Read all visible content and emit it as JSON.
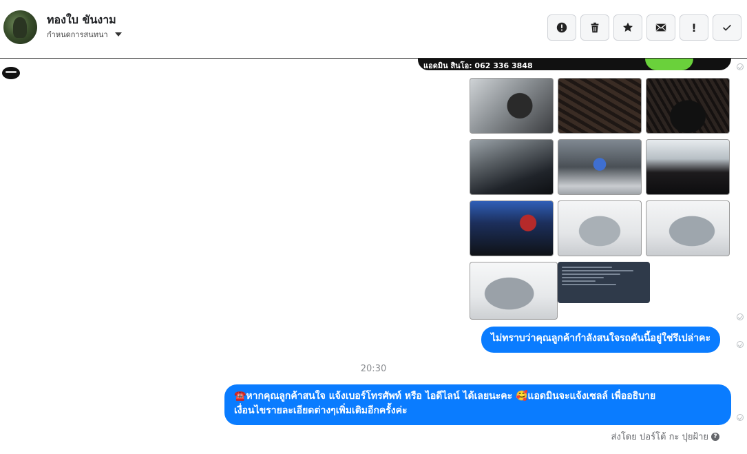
{
  "header": {
    "contact_name": "ทองใบ ขันงาม",
    "assign_label": "กำหนดการสนทนา",
    "actions": [
      {
        "name": "mark-spam-button",
        "icon": "alert-circle-icon"
      },
      {
        "name": "delete-button",
        "icon": "trash-icon"
      },
      {
        "name": "star-button",
        "icon": "star-icon"
      },
      {
        "name": "mark-unread-button",
        "icon": "envelope-icon"
      },
      {
        "name": "important-button",
        "icon": "exclamation-icon",
        "text": "!"
      },
      {
        "name": "mark-done-button",
        "icon": "check-icon"
      }
    ]
  },
  "chat": {
    "banner_text": "แอดมิน สินโอ: 062 336 3848",
    "photos": [
      {
        "name": "photo-interior-steering",
        "icon": "image-icon"
      },
      {
        "name": "photo-interior-seats-front",
        "icon": "image-icon"
      },
      {
        "name": "photo-interior-seats-side",
        "icon": "image-icon"
      },
      {
        "name": "photo-dashboard",
        "icon": "image-icon"
      },
      {
        "name": "photo-engine",
        "icon": "image-icon"
      },
      {
        "name": "photo-rear-seat",
        "icon": "image-icon"
      },
      {
        "name": "photo-battery",
        "icon": "image-icon"
      },
      {
        "name": "photo-car-front-left",
        "icon": "image-icon"
      },
      {
        "name": "photo-car-front-right",
        "icon": "image-icon"
      },
      {
        "name": "photo-car-rear",
        "icon": "image-icon"
      },
      {
        "name": "photo-document",
        "icon": "image-icon"
      }
    ],
    "message_1": "ไม่ทราบว่าคุณลูกค้ากำลังสนใจรถคันนี้อยู่ใช่รึเปล่าคะ",
    "timestamp": "20:30",
    "message_2_line1": "☎️หากคุณลูกค้าสนใจ แจ้งเบอร์โทรศัพท์ หรือ ไอดีไลน์  ได้เลยนะคะ 🥰แอดมินจะแจ้งเซลล์   เพื่ออธิบาย",
    "message_2_line2": "เงื่อนไขรายละเอียดต่างๆเพิ่มเติมอีกครั้งค่ะ",
    "sent_by": "ส่งโดย ปอร์โต้ กะ ปุยฝ้าย"
  },
  "colors": {
    "bubble": "#0a7cff",
    "header_border": "#222222"
  }
}
